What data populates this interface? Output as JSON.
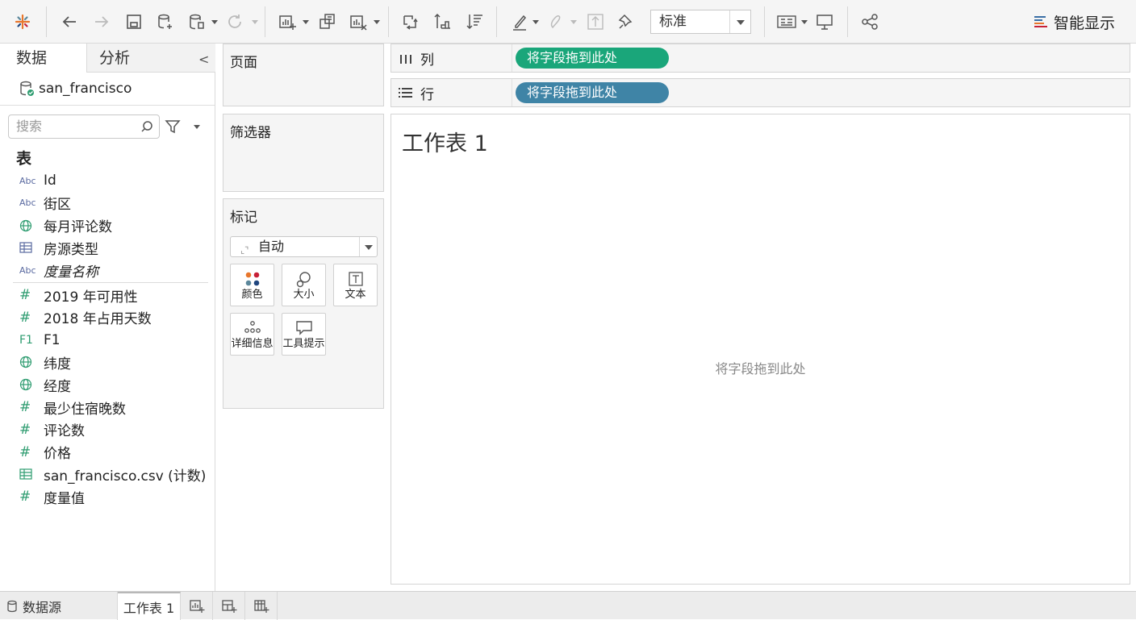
{
  "toolbar": {
    "view_mode": "标准",
    "show_me": "智能显示",
    "icons": [
      "tableau-logo-icon",
      "undo-icon",
      "redo-icon",
      "save-icon",
      "new-datasource-icon",
      "pause-update-icon",
      "refresh-icon",
      "new-worksheet-icon",
      "duplicate-sheet-icon",
      "clear-sheet-icon",
      "swap-rows-columns-icon",
      "sort-ascending-icon",
      "sort-descending-icon",
      "highlight-icon",
      "group-icon",
      "labels-icon",
      "fix-axes-icon",
      "fit-icon",
      "presentation-mode-icon",
      "share-icon",
      "show-me-icon"
    ]
  },
  "sidebar": {
    "tabs": {
      "data": "数据",
      "analysis": "分析"
    },
    "collapse": "<",
    "datasource": "san_francisco",
    "search_placeholder": "搜索",
    "tables_heading": "表",
    "dimension_fields": [
      {
        "icon": "Abc",
        "type": "string",
        "label": "Id",
        "italic": false
      },
      {
        "icon": "Abc",
        "type": "string",
        "label": "街区",
        "italic": false
      },
      {
        "icon": "globe",
        "type": "geo",
        "label": "每月评论数",
        "italic": false
      },
      {
        "icon": "table",
        "type": "table",
        "label": "房源类型",
        "italic": false
      },
      {
        "icon": "Abc",
        "type": "string",
        "label": "度量名称",
        "italic": true
      }
    ],
    "measure_fields": [
      {
        "icon": "#",
        "type": "number",
        "label": "2019 年可用性"
      },
      {
        "icon": "#",
        "type": "number",
        "label": "2018 年占用天数"
      },
      {
        "icon": "F1",
        "type": "f1",
        "label": "F1"
      },
      {
        "icon": "globe",
        "type": "geo",
        "label": "纬度"
      },
      {
        "icon": "globe",
        "type": "geo",
        "label": "经度"
      },
      {
        "icon": "#",
        "type": "number",
        "label": "最少住宿晚数"
      },
      {
        "icon": "#",
        "type": "number",
        "label": "评论数"
      },
      {
        "icon": "#",
        "type": "number",
        "label": "价格"
      },
      {
        "icon": "table",
        "type": "table",
        "label": "san_francisco.csv (计数)"
      },
      {
        "icon": "#",
        "type": "number",
        "label": "度量值"
      }
    ]
  },
  "cards": {
    "pages": "页面",
    "filters": "筛选器",
    "marks": {
      "title": "标记",
      "type": "自动",
      "buttons": {
        "color": "颜色",
        "size": "大小",
        "text": "文本",
        "detail": "详细信息",
        "tooltip": "工具提示"
      }
    }
  },
  "shelves": {
    "columns": {
      "label": "列",
      "pill": "将字段拖到此处",
      "color": "#1aa67a"
    },
    "rows": {
      "label": "行",
      "pill": "将字段拖到此处",
      "color": "#3f84a6"
    }
  },
  "canvas": {
    "sheet_title": "工作表 1",
    "drop_hint": "将字段拖到此处"
  },
  "bottom_tabs": {
    "data_source": "数据源",
    "sheet": "工作表 1"
  }
}
